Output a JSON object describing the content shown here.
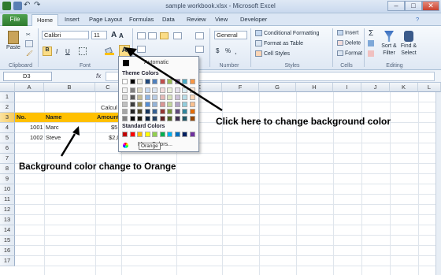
{
  "app": {
    "title": "sample workbook.xlsx - Microsoft Excel",
    "window_buttons": [
      "–",
      "□",
      "✕"
    ]
  },
  "tabs": [
    "Home",
    "Insert",
    "Page Layout",
    "Formulas",
    "Data",
    "Review",
    "View",
    "Developer"
  ],
  "file_tab": "File",
  "ribbon": {
    "clipboard": {
      "label": "Clipboard",
      "paste": "Paste"
    },
    "font": {
      "label": "Font",
      "font_name": "Calibri",
      "font_size": "11",
      "grow": "A",
      "shrink": "A",
      "bold": "B",
      "italic": "I",
      "underline": "U"
    },
    "number": {
      "label": "Number",
      "format": "General",
      "currency": "$",
      "percent": "%",
      "comma": ","
    },
    "styles": {
      "label": "Styles",
      "conditional": "Conditional Formatting",
      "format_table": "Format as Table",
      "cell_styles": "Cell Styles"
    },
    "cells": {
      "label": "Cells",
      "insert": "Insert",
      "delete": "Delete",
      "format": "Format"
    },
    "editing": {
      "label": "Editing",
      "sum": "Σ",
      "sort": "Sort &",
      "sort2": "Filter",
      "find": "Find &",
      "find2": "Select"
    }
  },
  "formula_bar": {
    "name_box": "D3",
    "fx": "fx"
  },
  "columns": [
    "A",
    "B",
    "C",
    "D",
    "E",
    "F",
    "G",
    "H",
    "I",
    "J",
    "K",
    "L"
  ],
  "rows": [
    "1",
    "2",
    "3",
    "4",
    "5",
    "6",
    "7",
    "8",
    "9",
    "10",
    "11",
    "12",
    "13",
    "14",
    "15",
    "16",
    "17"
  ],
  "sheet": {
    "c2": "Calcul",
    "header": {
      "a3": "No.",
      "b3": "Name",
      "c3": "Amount"
    },
    "row4": {
      "a": "1001",
      "b": "Marc",
      "c": "$5,"
    },
    "row5": {
      "a": "1002",
      "b": "Steve",
      "c": "$2,0"
    }
  },
  "fill_dropdown": {
    "automatic": "Automatic",
    "theme_colors": "Theme Colors",
    "standard_colors": "Standard Colors",
    "more": "More Colors...",
    "tooltip": "Orange",
    "theme_top": [
      "#ffffff",
      "#000000",
      "#eeece1",
      "#1f497d",
      "#4f81bd",
      "#c0504d",
      "#9bbb59",
      "#8064a2",
      "#4bacc6",
      "#f79646"
    ],
    "theme_shades": [
      [
        "#f2f2f2",
        "#7f7f7f",
        "#ddd9c3",
        "#c6d9f0",
        "#dbe5f1",
        "#f2dcdb",
        "#ebf1dd",
        "#e5e0ec",
        "#dbeef3",
        "#fdeada"
      ],
      [
        "#d8d8d8",
        "#595959",
        "#c4bd97",
        "#8db3e2",
        "#b8cce4",
        "#e5b9b7",
        "#d7e3bc",
        "#ccc1d9",
        "#b7dde8",
        "#fbd5b5"
      ],
      [
        "#bfbfbf",
        "#3f3f3f",
        "#938953",
        "#548dd4",
        "#95b3d7",
        "#d99694",
        "#c3d69b",
        "#b2a2c7",
        "#92cddc",
        "#fac08f"
      ],
      [
        "#a5a5a5",
        "#262626",
        "#494429",
        "#17365d",
        "#366092",
        "#953734",
        "#76923c",
        "#5f497a",
        "#31859b",
        "#e36c09"
      ],
      [
        "#7f7f7f",
        "#0c0c0c",
        "#1d1b10",
        "#0f243e",
        "#244061",
        "#632423",
        "#4f6128",
        "#3f3151",
        "#205867",
        "#974806"
      ]
    ],
    "standard": [
      "#c00000",
      "#ff0000",
      "#ffc000",
      "#ffff00",
      "#92d050",
      "#00b050",
      "#00b0f0",
      "#0070c0",
      "#002060",
      "#7030a0"
    ]
  },
  "annotations": {
    "bg_color_note": "Click here to change background color",
    "orange_note": "Background color change to Orange"
  },
  "colors": {
    "header_fill": "#ffc000",
    "accent": "#2e7a2e"
  }
}
